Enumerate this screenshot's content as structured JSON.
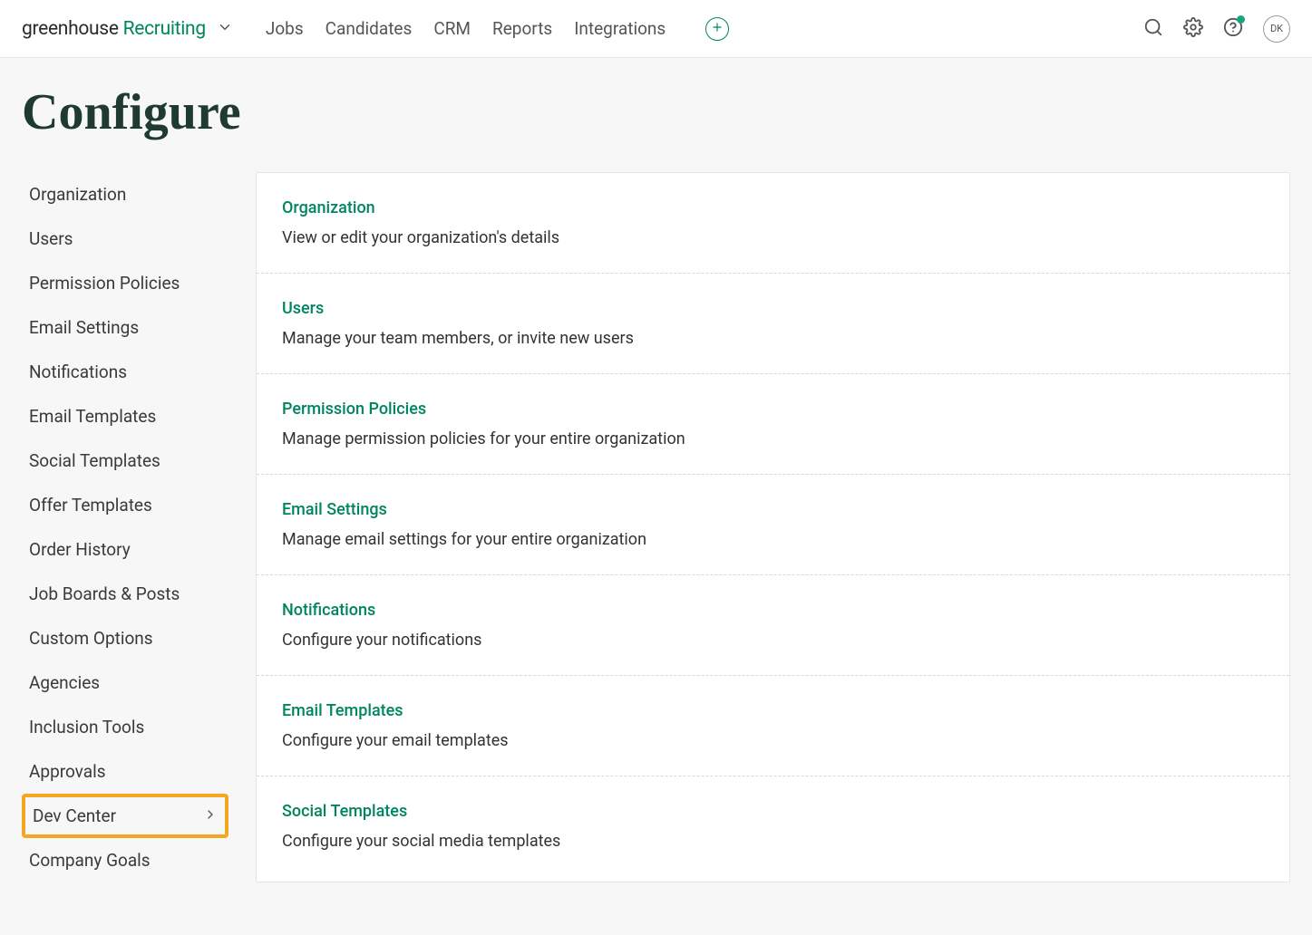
{
  "logo": {
    "part1": "greenhouse",
    "part2": " Recruiting"
  },
  "nav": {
    "items": [
      "Jobs",
      "Candidates",
      "CRM",
      "Reports",
      "Integrations"
    ]
  },
  "avatar": "DK",
  "page_title": "Configure",
  "sidebar": {
    "items": [
      {
        "label": "Organization",
        "highlighted": false,
        "chevron": false
      },
      {
        "label": "Users",
        "highlighted": false,
        "chevron": false
      },
      {
        "label": "Permission Policies",
        "highlighted": false,
        "chevron": false
      },
      {
        "label": "Email Settings",
        "highlighted": false,
        "chevron": false
      },
      {
        "label": "Notifications",
        "highlighted": false,
        "chevron": false
      },
      {
        "label": "Email Templates",
        "highlighted": false,
        "chevron": false
      },
      {
        "label": "Social Templates",
        "highlighted": false,
        "chevron": false
      },
      {
        "label": "Offer Templates",
        "highlighted": false,
        "chevron": false
      },
      {
        "label": "Order History",
        "highlighted": false,
        "chevron": false
      },
      {
        "label": "Job Boards & Posts",
        "highlighted": false,
        "chevron": false
      },
      {
        "label": "Custom Options",
        "highlighted": false,
        "chevron": false
      },
      {
        "label": "Agencies",
        "highlighted": false,
        "chevron": false
      },
      {
        "label": "Inclusion Tools",
        "highlighted": false,
        "chevron": false
      },
      {
        "label": "Approvals",
        "highlighted": false,
        "chevron": false
      },
      {
        "label": "Dev Center",
        "highlighted": true,
        "chevron": true
      },
      {
        "label": "Company Goals",
        "highlighted": false,
        "chevron": false
      }
    ]
  },
  "main": {
    "items": [
      {
        "title": "Organization",
        "desc": "View or edit your organization's details"
      },
      {
        "title": "Users",
        "desc": "Manage your team members, or invite new users"
      },
      {
        "title": "Permission Policies",
        "desc": "Manage permission policies for your entire organization"
      },
      {
        "title": "Email Settings",
        "desc": "Manage email settings for your entire organization"
      },
      {
        "title": "Notifications",
        "desc": "Configure your notifications"
      },
      {
        "title": "Email Templates",
        "desc": "Configure your email templates"
      },
      {
        "title": "Social Templates",
        "desc": "Configure your social media templates"
      }
    ]
  }
}
